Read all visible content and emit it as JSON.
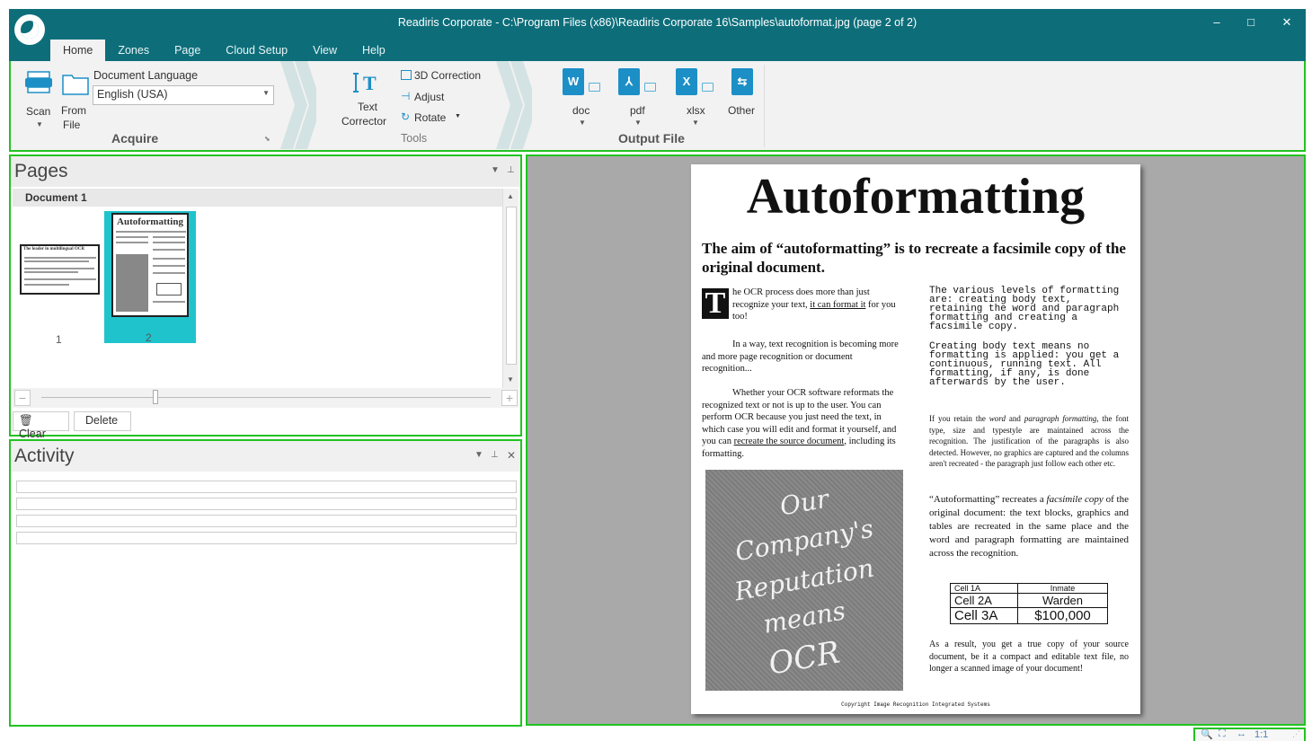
{
  "window": {
    "title": "Readiris Corporate - C:\\Program Files (x86)\\Readiris Corporate 16\\Samples\\autoformat.jpg (page 2 of 2)",
    "minimize": "‒",
    "maximize": "□",
    "close": "✕"
  },
  "tabs": [
    {
      "label": "Home"
    },
    {
      "label": "Zones"
    },
    {
      "label": "Page"
    },
    {
      "label": "Cloud Setup"
    },
    {
      "label": "View"
    },
    {
      "label": "Help"
    }
  ],
  "ribbon": {
    "acquire": {
      "scan_label": "Scan",
      "from_file_label_1": "From",
      "from_file_label_2": "File",
      "language_label": "Document Language",
      "language_value": "English (USA)",
      "group_label": "Acquire"
    },
    "tools": {
      "text_corrector_1": "Text",
      "text_corrector_2": "Corrector",
      "correction_3d": "3D Correction",
      "adjust": "Adjust",
      "rotate": "Rotate",
      "group_label": "Tools"
    },
    "output": {
      "doc": "doc",
      "pdf": "pdf",
      "xlsx": "xlsx",
      "other": "Other",
      "group_label": "Output File"
    }
  },
  "pages_panel": {
    "title": "Pages",
    "document_label": "Document 1",
    "thumb1_title": "The leader in multilingual OCR",
    "thumb2_title": "Autoformatting",
    "pages": [
      "1",
      "2"
    ],
    "clear_label": "Clear",
    "delete_label": "Delete"
  },
  "activity_panel": {
    "title": "Activity"
  },
  "document": {
    "title": "Autoformatting",
    "subtitle": "The aim of “autoformatting” is to recreate a facsimile copy of the original document.",
    "dropcap": "T",
    "para1_pre": "he OCR process does more than just recognize your text, ",
    "para1_link": "it can format it",
    "para1_post": " for you too!",
    "para2": "In a way, text recognition is becoming more and more page recognition or document recognition...",
    "para3_pre": "Whether your OCR software reformats the recognized text or not is up to the user. You can perform OCR because you just need the text, in which case you will edit and format it yourself, and you can ",
    "para3_link": "recreate the source document",
    "para3_post": ", including its formatting.",
    "photo_lines": [
      "Our",
      "Company's",
      "Reputation",
      "means",
      "OCR"
    ],
    "col2_para1": "The various levels of formatting are: creating body text, retaining the word and paragraph formatting and creating a facsimile copy.",
    "col2_para2": "Creating body text means no formatting is applied: you get a continuous, running text. All formatting, if any, is done afterwards by the user.",
    "col2_para3_pre": "If you retain the ",
    "col2_para3_em1": "word",
    "col2_para3_mid": " and ",
    "col2_para3_em2": "paragraph formatting",
    "col2_para3_post": ", the font type, size and typestyle are maintained across the recognition. The justification of the paragraphs is also detected. However, no graphics are captured and the columns aren't recreated - the paragraph just follow each other etc.",
    "col2_para4_pre": "“Autoformatting” recreates a ",
    "col2_para4_em": "facsimile copy",
    "col2_para4_post": " of the original document: the text blocks, graphics and tables are recreated in the same place and the word and paragraph formatting are maintained across the recognition.",
    "table": [
      [
        "Cell 1A",
        "Inmate"
      ],
      [
        "Cell 2A",
        "Warden"
      ],
      [
        "Cell 3A",
        "$100,000"
      ]
    ],
    "col2_para5": "As a result, you get a true copy of your source document, be it a compact and editable text file, no longer a scanned image of your document!",
    "copyright": "Copyright Image Recognition Integrated Systems"
  },
  "statusbar": {
    "zoom_ratio": "1:1"
  },
  "colors": {
    "titlebar": "#0d6e7a",
    "highlight_border": "#22c322",
    "thumb_selected": "#1fc3cc",
    "doc_icon": "#1c8fc7"
  },
  "icons": [
    "app-logo-icon",
    "scanner-icon",
    "folder-icon",
    "text-corrector-icon",
    "3d-correction-icon",
    "adjust-icon",
    "rotate-icon",
    "word-doc-icon",
    "pdf-icon",
    "excel-icon",
    "other-format-icon",
    "trash-icon",
    "zoom-icon",
    "fit-page-icon",
    "fit-width-icon"
  ]
}
